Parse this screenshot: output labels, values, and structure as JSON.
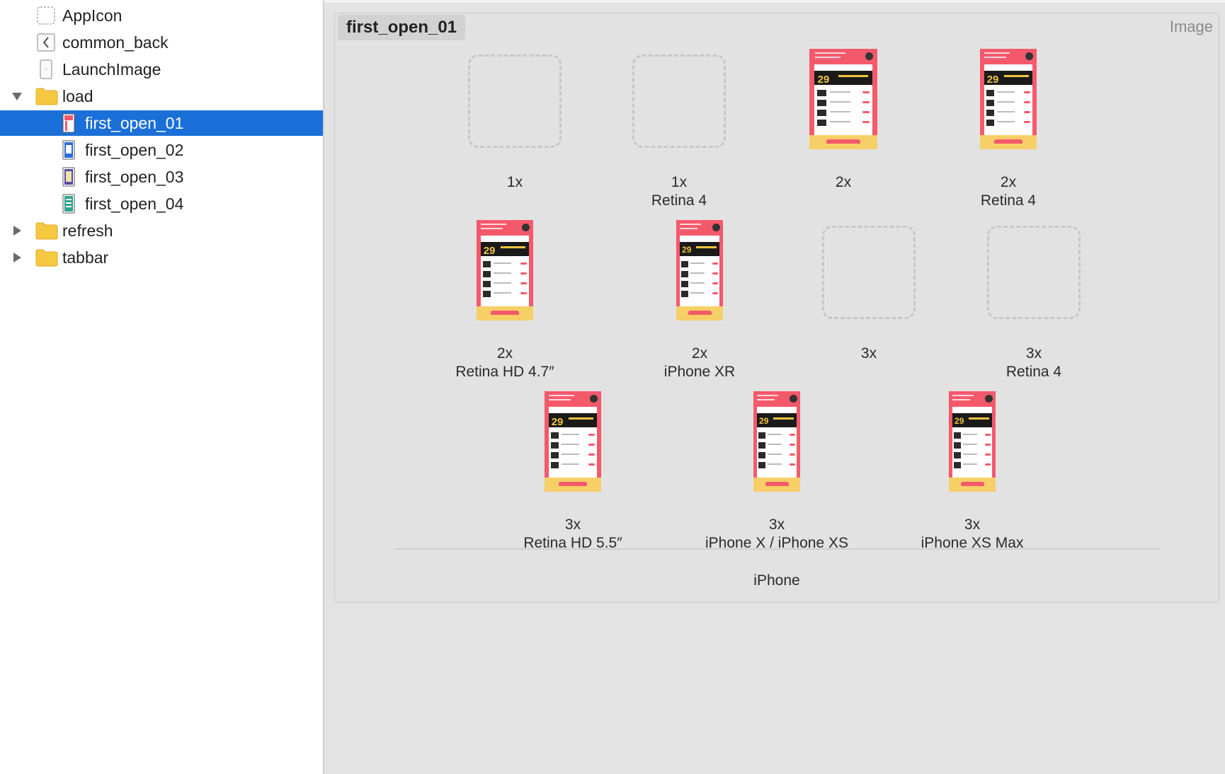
{
  "sidebar": {
    "items": [
      {
        "label": "AppIcon",
        "icon": "appicon-set-icon",
        "kind": "set"
      },
      {
        "label": "common_back",
        "icon": "image-set-back-icon",
        "kind": "set"
      },
      {
        "label": "LaunchImage",
        "icon": "launch-image-icon",
        "kind": "set"
      },
      {
        "label": "load",
        "icon": "folder-icon",
        "kind": "folder",
        "state": "expanded"
      },
      {
        "label": "first_open_01",
        "icon": "image-set-icon",
        "kind": "set",
        "selected": true
      },
      {
        "label": "first_open_02",
        "icon": "image-set-icon",
        "kind": "set"
      },
      {
        "label": "first_open_03",
        "icon": "image-set-icon",
        "kind": "set"
      },
      {
        "label": "first_open_04",
        "icon": "image-set-icon",
        "kind": "set"
      },
      {
        "label": "refresh",
        "icon": "folder-icon",
        "kind": "folder",
        "state": "collapsed"
      },
      {
        "label": "tabbar",
        "icon": "folder-icon",
        "kind": "folder",
        "state": "collapsed"
      }
    ]
  },
  "panel": {
    "title": "first_open_01",
    "type_label": "Image",
    "group_label": "iPhone",
    "slots": [
      {
        "scale": "1x",
        "device": "",
        "filled": false
      },
      {
        "scale": "1x",
        "device": "Retina 4",
        "filled": false
      },
      {
        "scale": "2x",
        "device": "",
        "filled": true
      },
      {
        "scale": "2x",
        "device": "Retina 4",
        "filled": true
      },
      {
        "scale": "2x",
        "device": "Retina HD 4.7″",
        "filled": true
      },
      {
        "scale": "2x",
        "device": "iPhone XR",
        "filled": true
      },
      {
        "scale": "3x",
        "device": "",
        "filled": false
      },
      {
        "scale": "3x",
        "device": "Retina 4",
        "filled": false
      },
      {
        "scale": "3x",
        "device": "Retina HD 5.5″",
        "filled": true
      },
      {
        "scale": "3x",
        "device": "iPhone X / iPhone XS",
        "filled": true
      },
      {
        "scale": "3x",
        "device": "iPhone XS Max",
        "filled": true
      }
    ],
    "thumb_banner_number": "29"
  },
  "colors": {
    "selection": "#1b6fd8",
    "folder": "#f5c842",
    "thumb_pink": "#f4596b",
    "thumb_yellow": "#f7cf67"
  }
}
